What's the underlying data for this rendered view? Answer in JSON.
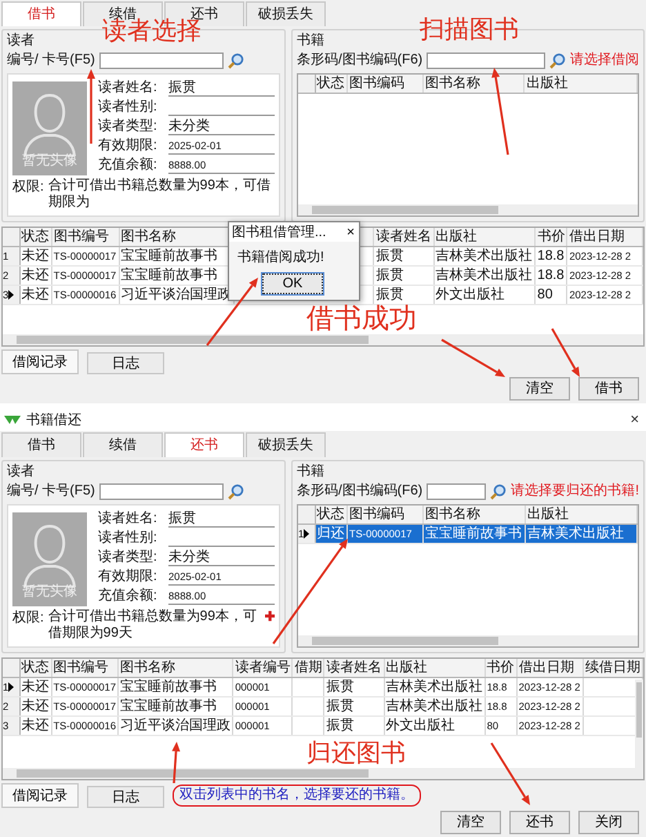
{
  "panels": [
    {
      "tabs": [
        {
          "label": "借书",
          "selected": true
        },
        {
          "label": "续借",
          "selected": false
        },
        {
          "label": "还书",
          "selected": false
        },
        {
          "label": "破损丢失",
          "selected": false
        }
      ],
      "reader": {
        "group_label": "读者",
        "card_label": "编号/ 卡号(F5)",
        "photo_caption": "暂无头像",
        "fields": [
          {
            "label": "读者姓名:",
            "value": "振贯"
          },
          {
            "label": "读者性别:"
          },
          {
            "label": "读者类型:",
            "value": "未分类"
          },
          {
            "label": "有效期限:",
            "value": "2025-02-01"
          },
          {
            "label": "充值余额:",
            "value": "8888.00"
          }
        ],
        "permission_label": "权限:",
        "permission_text": "合计可借出书籍总数量为99本，可借期限为"
      },
      "books": {
        "group_label": "书籍",
        "code_label": "条形码/图书编码(F6)",
        "hint": "请选择借阅",
        "columns": [
          "状态",
          "图书编码",
          "图书名称",
          "出版社"
        ]
      },
      "records": {
        "columns": [
          "状态",
          "图书编号",
          "图书名称",
          "读者姓名",
          "出版社",
          "书价",
          "借出日期"
        ],
        "rows": [
          {
            "number": "1",
            "current": false,
            "cells": [
              "未还",
              "TS-00000017",
              "宝宝睡前故事书",
              "振贯",
              "吉林美术出版社",
              "18.8",
              "2023-12-28 2"
            ]
          },
          {
            "number": "2",
            "current": false,
            "cells": [
              "未还",
              "TS-00000017",
              "宝宝睡前故事书",
              "振贯",
              "吉林美术出版社",
              "18.8",
              "2023-12-28 2"
            ]
          },
          {
            "number": "3",
            "current": true,
            "cells": [
              "未还",
              "TS-00000016",
              "习近平谈治国理政",
              "振贯",
              "外文出版社",
              "80",
              "2023-12-28 2"
            ]
          }
        ]
      },
      "dialog": {
        "title": "图书租借管理...",
        "close": "×",
        "message": "书籍借阅成功!",
        "button": "OK"
      },
      "bottom_tabs": [
        {
          "label": "借阅记录",
          "selected": true
        },
        {
          "label": "日志",
          "selected": false
        }
      ],
      "buttons": [
        "清空",
        "借书"
      ],
      "annotations": [
        "读者选择",
        "扫描图书",
        "借书成功"
      ]
    },
    {
      "title": "书籍借还",
      "close": "×",
      "tabs": [
        {
          "label": "借书",
          "selected": false
        },
        {
          "label": "续借",
          "selected": false
        },
        {
          "label": "还书",
          "selected": true
        },
        {
          "label": "破损丢失",
          "selected": false
        }
      ],
      "reader": {
        "group_label": "读者",
        "card_label": "编号/ 卡号(F5)",
        "photo_caption": "暂无头像",
        "fields": [
          {
            "label": "读者姓名:",
            "value": "振贯"
          },
          {
            "label": "读者性别:"
          },
          {
            "label": "读者类型:",
            "value": "未分类"
          },
          {
            "label": "有效期限:",
            "value": "2025-02-01"
          },
          {
            "label": "充值余额:",
            "value": "8888.00"
          }
        ],
        "recharge_icon": true,
        "permission_label": "权限:",
        "permission_text": "合计可借出书籍总数量为99本，可借期限为99天"
      },
      "books": {
        "group_label": "书籍",
        "code_label": "条形码/图书编码(F6)",
        "hint": "请选择要归还的书籍!",
        "columns": [
          "状态",
          "图书编码",
          "图书名称",
          "出版社"
        ],
        "rows": [
          {
            "number": "1",
            "current": true,
            "selected": true,
            "cells": [
              "归还",
              "TS-00000017",
              "宝宝睡前故事书",
              "吉林美术出版社"
            ]
          }
        ]
      },
      "records": {
        "columns": [
          "状态",
          "图书编号",
          "图书名称",
          "读者编号",
          "借期",
          "读者姓名",
          "出版社",
          "书价",
          "借出日期",
          "续借日期"
        ],
        "rows": [
          {
            "number": "1",
            "current": true,
            "cells": [
              "未还",
              "TS-00000017",
              "宝宝睡前故事书",
              "000001",
              "",
              "振贯",
              "吉林美术出版社",
              "18.8",
              "2023-12-28 2",
              ""
            ]
          },
          {
            "number": "2",
            "current": false,
            "cells": [
              "未还",
              "TS-00000017",
              "宝宝睡前故事书",
              "000001",
              "",
              "振贯",
              "吉林美术出版社",
              "18.8",
              "2023-12-28 2",
              ""
            ]
          },
          {
            "number": "3",
            "current": false,
            "cells": [
              "未还",
              "TS-00000016",
              "习近平谈治国理政",
              "000001",
              "",
              "振贯",
              "外文出版社",
              "80",
              "2023-12-28 2",
              ""
            ]
          }
        ]
      },
      "bottom_tabs": [
        {
          "label": "借阅记录",
          "selected": true
        },
        {
          "label": "日志",
          "selected": false
        }
      ],
      "hint": {
        "text": "双击列表中的书名，选择要还的书籍。",
        "circled": true
      },
      "buttons": [
        "清空",
        "还书",
        "关闭"
      ],
      "annotations": [
        "归还图书"
      ]
    }
  ]
}
